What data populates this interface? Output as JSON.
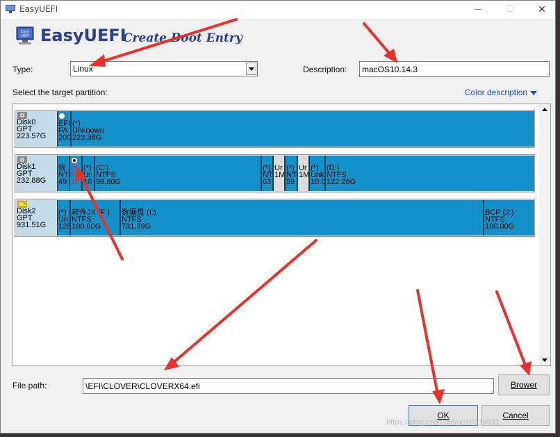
{
  "window": {
    "title": "EasyUEFI",
    "controls": {
      "minimize": "—",
      "maximize": "☐",
      "close": "✕"
    }
  },
  "header": {
    "logo_text": "Easy UEFI",
    "brand": "EasyUEFI",
    "subtitle": "Create Boot Entry"
  },
  "form": {
    "type_label": "Type:",
    "type_value": "Linux",
    "description_label": "Description:",
    "description_value": "macOS10.14.3",
    "select_partition_label": "Select the target partition:",
    "color_description": "Color description",
    "file_path_label": "File path:",
    "file_path_value": "\\EFI\\CLOVER\\CLOVERX64.efi"
  },
  "disks": [
    {
      "name": "Disk0",
      "style": "GPT",
      "size": "223.57G",
      "partitions": [
        {
          "l1": "EFI",
          "l2": "FA",
          "l3": "200",
          "radio": "empty"
        },
        {
          "l1": "(*)",
          "l2": "Unknown",
          "l3": "223.38G"
        }
      ]
    },
    {
      "name": "Disk1",
      "style": "GPT",
      "size": "232.88G",
      "partitions": [
        {
          "l1": "恢",
          "l2": "NT",
          "l3": "49"
        },
        {
          "l1": "(*)",
          "l2": "FA",
          "l3": "10",
          "radio": "selected",
          "red": true
        },
        {
          "l1": "(*)",
          "l2": "Ur",
          "l3": "16"
        },
        {
          "l1": "(C:)",
          "l2": "NTFS",
          "l3": "98.80G"
        },
        {
          "l1": "(*)",
          "l2": "NT",
          "l3": "63"
        },
        {
          "l1": "Ur",
          "l2": "1M",
          "l3": "",
          "free": true
        },
        {
          "l1": "(*)",
          "l2": "NT",
          "l3": "59"
        },
        {
          "l1": "Ur",
          "l2": "1M",
          "l3": "",
          "free": true
        },
        {
          "l1": "(*)",
          "l2": "Unk",
          "l3": "10.0"
        },
        {
          "l1": "(D:)",
          "l2": "NTFS",
          "l3": "122.28G"
        }
      ]
    },
    {
      "name": "Disk2",
      "style": "GPT",
      "size": "931.51G",
      "partitions": [
        {
          "l1": "(*)",
          "l2": "Un",
          "l3": "128"
        },
        {
          "l1": "软件JX (F:)",
          "l2": "NTFS",
          "l3": "100.00G"
        },
        {
          "l1": "数据盘 (I:)",
          "l2": "NTFS",
          "l3": "731.39G"
        },
        {
          "l1": "BCP (J:)",
          "l2": "NTFS",
          "l3": "100.00G"
        }
      ]
    }
  ],
  "buttons": {
    "browse": "Brower",
    "ok": "OK",
    "cancel": "Cancel"
  },
  "watermark": "https://blog.csdn.net/u010339931",
  "colors": {
    "brand": "#2a3e96",
    "partition": "#1391c8",
    "disk_info": "#c3dbe9",
    "link": "#1e4fc4",
    "annotation_arrow": "#e8312a"
  }
}
